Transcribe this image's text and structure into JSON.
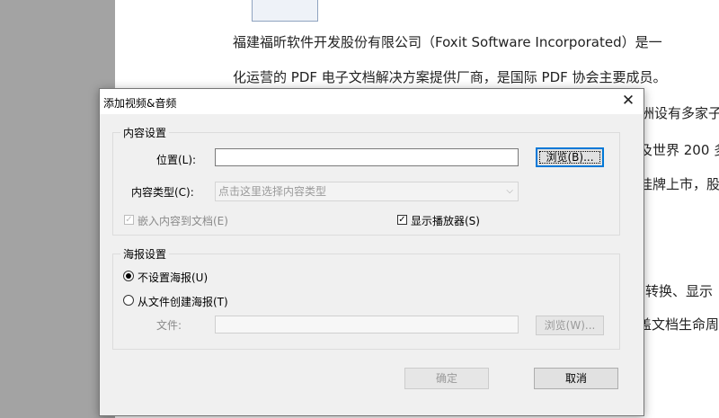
{
  "document": {
    "lines": [
      "福建福昕软件开发股份有限公司（Foxit Software Incorporated）是一",
      "化运营的 PDF 电子文档解决方案提供厂商，是国际 PDF 协会主要成员。"
    ],
    "right_fragments": [
      "洲设有多家子",
      "及世界 200 多",
      "挂牌上市，股",
      "转换、显示",
      "盖文档生命周"
    ]
  },
  "dialog": {
    "title": "添加视频&音频",
    "close_glyph": "✕",
    "content_group": {
      "title": "内容设置",
      "location_label": "位置(L):",
      "location_value": "",
      "browse_button": "浏览(B)...",
      "content_type_label": "内容类型(C):",
      "content_type_placeholder": "点击这里选择内容类型",
      "embed_label": "嵌入内容到文档(E)",
      "embed_checked": true,
      "show_player_label": "显示播放器(S)",
      "show_player_checked": true
    },
    "poster_group": {
      "title": "海报设置",
      "no_poster_label": "不设置海报(U)",
      "from_file_label": "从文件创建海报(T)",
      "selected": "no_poster",
      "file_label": "文件:",
      "file_value": "",
      "browse_button": "浏览(W)..."
    },
    "ok_button": "确定",
    "cancel_button": "取消"
  }
}
